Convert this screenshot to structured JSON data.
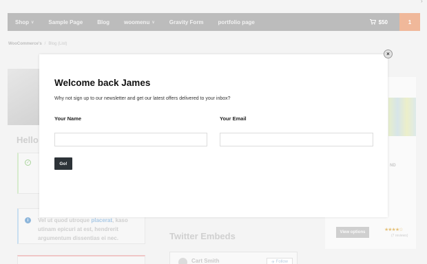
{
  "nav": {
    "items": [
      {
        "label": "Shop",
        "has_dropdown": true
      },
      {
        "label": "Sample Page",
        "has_dropdown": false
      },
      {
        "label": "Blog",
        "has_dropdown": false
      },
      {
        "label": "woomenu",
        "has_dropdown": true
      },
      {
        "label": "Gravity Form",
        "has_dropdown": false
      },
      {
        "label": "portfolio page",
        "has_dropdown": false
      }
    ],
    "cart_total": "$50",
    "cart_count": "1",
    "dropdown_glyph": "∨",
    "cart_icon": "cart-icon"
  },
  "breadcrumb": {
    "items": [
      "WooCommerce's",
      "Blog (List)"
    ],
    "separator": "/"
  },
  "background": {
    "hello_heading": "Hello",
    "notice_info_text_pre": "Vel ut quod utroque",
    "notice_info_link": "placerat",
    "notice_info_text_post": ", kaso utinam epicuri at est, hendrerit argumentum dissentias ei nec.",
    "twitter_title": "Twitter Embeds",
    "tweet_author": "Cart Smith",
    "follow_label": "Follow",
    "product_tag": "ND",
    "view_options_label": "View options",
    "stars": "★★★★☆",
    "reviews": "(7 reviews)"
  },
  "modal": {
    "title": "Welcome back James",
    "subtitle": "Why not sign up to our newsletter and get our latest offers delivered to your inbox?",
    "name_label": "Your Name",
    "email_label": "Your Email",
    "name_value": "",
    "email_value": "",
    "submit_label": "Go!",
    "close_glyph": "×"
  },
  "colors": {
    "nav_bg": "#bcbcbc",
    "cart_count_bg": "#f0b89a",
    "go_button_bg": "#2d3338"
  }
}
